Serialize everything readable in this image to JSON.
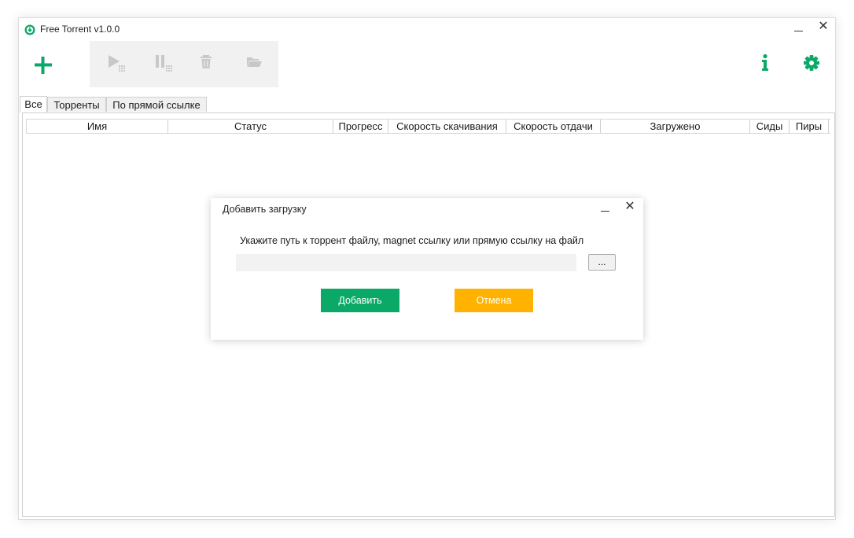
{
  "app": {
    "title": "Free Torrent v1.0.0",
    "accent_color": "#0aa968"
  },
  "window_controls": {
    "minimize_icon": "minimize-icon",
    "close_glyph": "✕"
  },
  "toolbar": {
    "add_icon": "plus-icon",
    "buttons": [
      "play-icon",
      "pause-icon",
      "trash-icon",
      "folder-icon"
    ],
    "info_icon": "info-icon",
    "settings_icon": "gear-icon"
  },
  "tabs": [
    {
      "label": "Все",
      "active": true
    },
    {
      "label": "Торренты",
      "active": false
    },
    {
      "label": "По прямой ссылке",
      "active": false
    }
  ],
  "table": {
    "columns": [
      "Имя",
      "Статус",
      "Прогресс",
      "Скорость скачивания",
      "Скорость отдачи",
      "Загружено",
      "Сиды",
      "Пиры"
    ],
    "rows": []
  },
  "dialog": {
    "title": "Добавить загрузку",
    "close_glyph": "✕",
    "prompt": "Укажите путь к торрент файлу, magnet ссылку или прямую ссылку на файл",
    "path_value": "",
    "browse_label": "...",
    "add_label": "Добавить",
    "cancel_label": "Отмена",
    "add_color": "#0aa968",
    "cancel_color": "#ffb300"
  }
}
